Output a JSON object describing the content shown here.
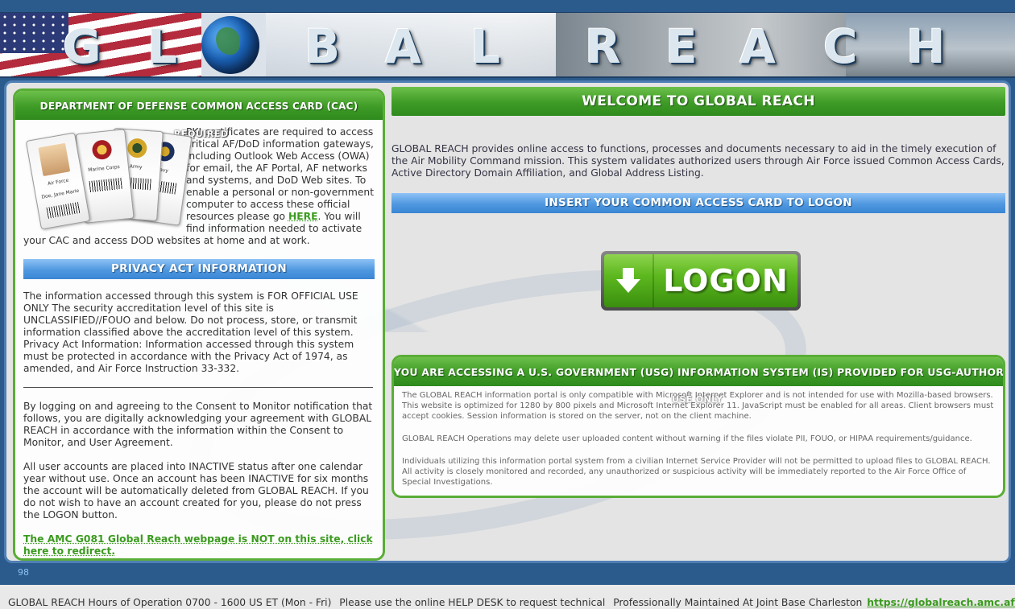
{
  "banner": {
    "letters": [
      "G",
      "L",
      "B",
      "A",
      "L",
      "R",
      "E",
      "A",
      "C",
      "H"
    ]
  },
  "cac": {
    "header": "DEPARTMENT OF DEFENSE COMMON ACCESS CARD (CAC)",
    "required_label": "REQUIRED",
    "text_before_link": "PKI certificates are required to access critical AF/DoD information gateways, including Outlook Web Access (OWA) for email, the AF Portal, AF networks and systems, and DoD Web sites. To enable a personal or non-government computer to access these official resources please go ",
    "link_label": "HERE",
    "text_after_link": ". You will find information needed to activate your CAC and access DOD websites at home and at work.",
    "cards": [
      {
        "label": "Air Force",
        "color": "#1f4b9a"
      },
      {
        "label": "Marine Corps",
        "color": "#a51d22"
      },
      {
        "label": "Army",
        "color": "#d3a629"
      },
      {
        "label": "Navy",
        "color": "#1c2f5e"
      }
    ],
    "card_name": "Doe, Jane Marie"
  },
  "privacy": {
    "header": "PRIVACY ACT INFORMATION",
    "para1": "The information accessed through this system is FOR OFFICIAL USE ONLY The security accreditation level of this site is UNCLASSIFIED//FOUO and below. Do not process, store, or transmit information classified above the accreditation level of this system. Privacy Act Information: Information accessed through this system must be protected in accordance with the Privacy Act of 1974, as amended, and Air Force Instruction 33-332.",
    "para2": "By logging on and agreeing to the Consent to Monitor notification that follows, you are digitally acknowledging your agreement with GLOBAL REACH in accordance with the information within the Consent to Monitor, and User Agreement.",
    "para3": "All user accounts are placed into INACTIVE status after one calendar year without use. Once an account has been INACTIVE for six months the account will be automatically deleted from GLOBAL REACH. If you do not wish to have an account created for you, please do not press the LOGON button.",
    "redirect_link": "The AMC G081 Global Reach webpage is NOT on this site, click here to redirect."
  },
  "main": {
    "welcome": "WELCOME TO GLOBAL REACH",
    "intro": "GLOBAL REACH provides online access to functions, processes and documents necessary to aid in the timely execution of the Air Mobility Command mission. This system validates authorized users through Air Force issued Common Access Cards, Active Directory Domain Affiliation, and Global Address Listing.",
    "insert_card": "INSERT YOUR COMMON ACCESS CARD TO LOGON",
    "logon_label": "LOGON"
  },
  "notice": {
    "header": "YOU ARE ACCESSING A U.S. GOVERNMENT (USG) INFORMATION SYSTEM (IS) PROVIDED FOR USG-AUTHORIZED",
    "usg_only": "USE ONLY",
    "para1": "The GLOBAL REACH information portal is only compatible with Microsoft Internet Explorer and is not intended for use with Mozilla-based browsers. This website is optimized for 1280 by 800 pixels and Microsoft Internet Explorer 11. JavaScript must be enabled for all areas. Client browsers must accept cookies. Session information is stored on the server, not on the client machine.",
    "para2": "GLOBAL REACH Operations may delete user uploaded content without warning if the files violate PII, FOUO, or HIPAA requirements/guidance.",
    "para3": "Individuals utilizing this information portal system from a civilian Internet Service Provider will not be permitted to upload files to GLOBAL REACH. All activity is closely monitored and recorded, any unauthorized or suspicious activity will be immediately reported to the Air Force Office of Special Investigations."
  },
  "footer": {
    "counter": "98",
    "hours": "GLOBAL REACH Hours of Operation 0700 - 1600 US ET (Mon - Fri)",
    "helpdesk": "Please use the online HELP DESK to request technical",
    "maintained": "Professionally Maintained At Joint Base Charleston",
    "url": "https://globalreach.amc.af.mil"
  }
}
